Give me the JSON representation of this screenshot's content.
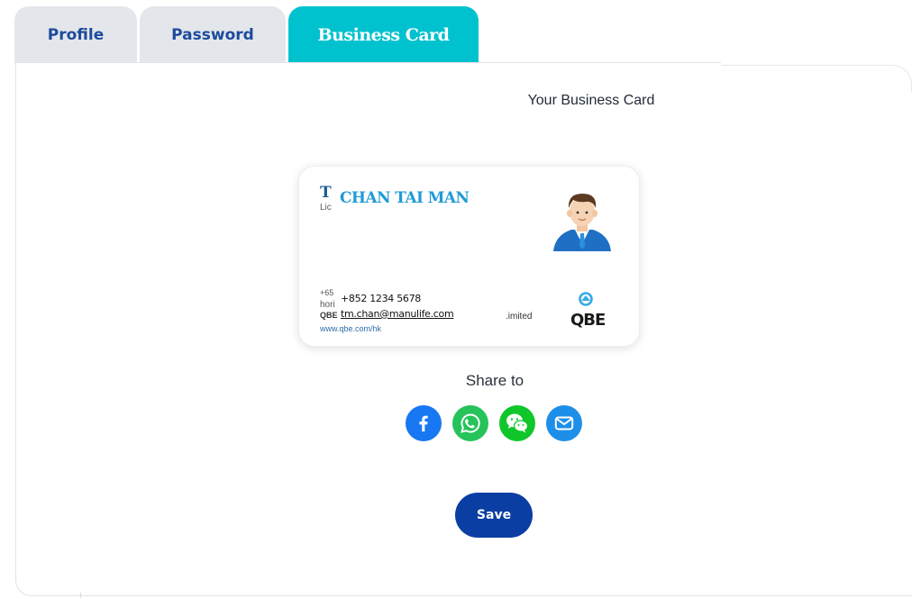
{
  "tabs": [
    {
      "label": "Profile",
      "active": false
    },
    {
      "label": "Password",
      "active": false
    },
    {
      "label": "Business Card",
      "active": true
    }
  ],
  "section_title": "Your Business Card",
  "card": {
    "initial": "T",
    "license_fragment": "Lic",
    "name": "CHAN TAI MAN",
    "phone": "+852 1234 5678",
    "email": "tm.chan@manulife.com",
    "faded_lines": [
      "+65",
      "hori",
      "QBE",
      "www.qbe.com/hk"
    ],
    "company_fragment": ".imited",
    "logo_text": "QBE",
    "avatar_icon": "man-avatar-icon"
  },
  "share": {
    "label": "Share to",
    "targets": [
      {
        "name": "facebook",
        "icon": "facebook-icon",
        "color": "#1877f2"
      },
      {
        "name": "whatsapp",
        "icon": "whatsapp-icon",
        "color": "#25c35a"
      },
      {
        "name": "wechat",
        "icon": "wechat-icon",
        "color": "#0fc72a"
      },
      {
        "name": "email",
        "icon": "email-icon",
        "color": "#1e8fe8"
      }
    ]
  },
  "save_label": "Save",
  "colors": {
    "tab_active": "#00c2ce",
    "tab_inactive": "#e3e6ea",
    "tab_inactive_text": "#1c4b9c",
    "save_button": "#0a3ea3",
    "card_name": "#1f9bd6"
  }
}
